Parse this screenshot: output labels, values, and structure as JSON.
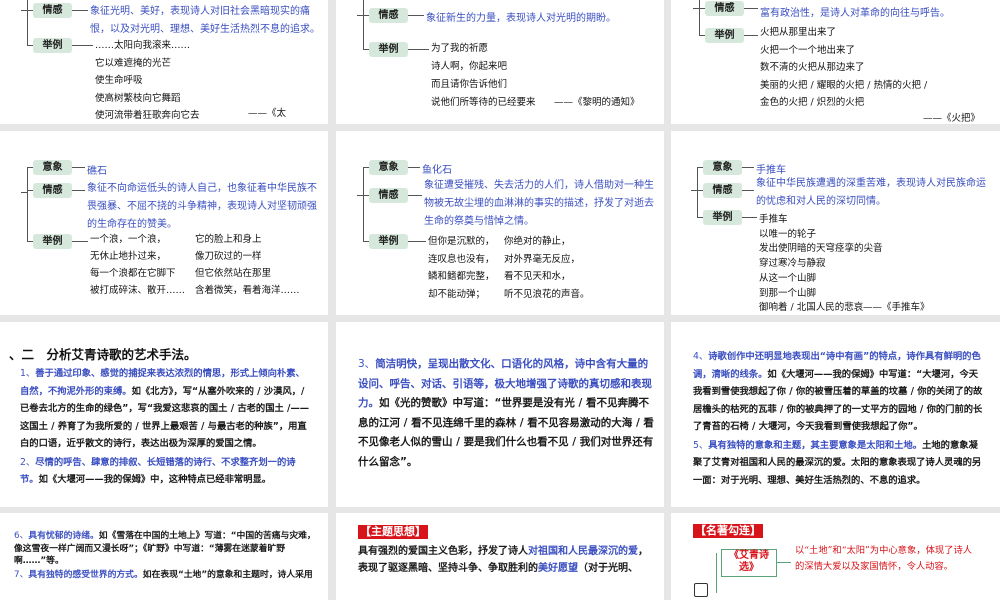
{
  "mindmaps": [
    {
      "nodes": [
        {
          "label": "情感",
          "text": [
            "象征光明、美好，表现诗人对旧社会黑暗现实的痛",
            "恨，以及对光明、理想、美好生活热烈不息的追求。"
          ]
        },
        {
          "label": "举例",
          "text": []
        }
      ],
      "poem_cols": [
        [
          "……太阳向我滚来……",
          "它以难遮掩的光芒",
          "使生命呼吸",
          "使高树繁枝向它舞蹈",
          "使河流带着狂歌奔向它去"
        ]
      ],
      "source": "——《太"
    },
    {
      "nodes": [
        {
          "label": "情感",
          "text": [
            "象征新生的力量，表现诗人对光明的期盼。"
          ]
        },
        {
          "label": "举例",
          "text": []
        }
      ],
      "poem_cols": [
        [
          "为了我的祈愿",
          "诗人啊，你起来吧",
          "而且请你告诉他们",
          "说他们所等待的已经要来"
        ]
      ],
      "source": "——《黎明的通知》"
    },
    {
      "nodes": [
        {
          "label": "情感",
          "text": [
            "富有政治性，是诗人对革命的向往与呼告。"
          ]
        },
        {
          "label": "举例",
          "text": []
        }
      ],
      "poem_cols": [
        [
          "火把从那里出来了",
          "火把一个一个地出来了",
          "数不清的火把从那边来了",
          "美丽的火把 / 耀眼的火把 / 热情的火把 /",
          "金色的火把 / 炽烈的火把"
        ]
      ],
      "source": "——《火把》"
    },
    {
      "nodes": [
        {
          "label": "意象",
          "text": [
            "礁石"
          ]
        },
        {
          "label": "情感",
          "text": [
            "象征不向命运低头的诗人自己，也象征着中华民族不",
            "畏强暴、不屈不挠的斗争精神，表现诗人对坚韧顽强",
            "的生命存在的赞美。"
          ]
        },
        {
          "label": "举例",
          "text": []
        }
      ],
      "poem_cols": [
        [
          "一个浪，一个浪，",
          "无休止地扑过来，",
          "每一个浪都在它脚下",
          "被打成碎沫、散开……"
        ],
        [
          "它的脸上和身上",
          "像刀砍过的一样",
          "但它依然站在那里",
          "含着微笑，看着海洋……"
        ]
      ],
      "source": ""
    },
    {
      "nodes": [
        {
          "label": "意象",
          "text": [
            "鱼化石"
          ]
        },
        {
          "label": "情感",
          "text": [
            "象征遭受摧残、失去活力的人们，诗人借助对一种生",
            "物被无故尘埋的血淋淋的事实的描述，抒发了对逝去",
            "生命的祭奠与惜悼之情。"
          ]
        },
        {
          "label": "举例",
          "text": []
        }
      ],
      "poem_cols": [
        [
          "但你是沉默的，",
          "连叹息也没有，",
          "鳞和鳍都完整，",
          "却不能动弹；"
        ],
        [
          "你绝对的静止，",
          "对外界毫无反应，",
          "看不见天和水，",
          "听不见浪花的声音。"
        ]
      ],
      "source": ""
    },
    {
      "nodes": [
        {
          "label": "意象",
          "text": [
            "手推车"
          ]
        },
        {
          "label": "情感",
          "text": [
            "象征中华民族遭遇的深重苦难，表现诗人对民族命运",
            "的忧虑和对人民的深切同情。"
          ]
        },
        {
          "label": "举例",
          "text": []
        }
      ],
      "poem_cols": [
        [
          "手推车",
          "以唯一的轮子",
          "发出使阴暗的天穹痉挛的尖音",
          "穿过寒冷与静寂",
          "从这一个山脚",
          "到那一个山脚",
          "御响着 / 北国人民的悲哀"
        ]
      ],
      "source": "——《手推车》"
    }
  ],
  "art_slide": {
    "title": "、二　分析艾青诗歌的艺术手法。",
    "paragraphs": [
      {
        "num": "1、",
        "blue": "善于通过印象、感觉的捕捉来表达浓烈的情思，形式上倾向朴素、自然，不拘泥外形的束缚。",
        "black": "如《北方》，写“从塞外吹来的 / 沙漠风，/ 已卷去北方的生命的绿色”，写“我爱这悲哀的国土 / 古老的国土 /—— 这国土 / 养育了为我所爱的 / 世界上最艰苦 / 与最古老的种族”，用直白的口语，近乎散文的诗行，表达出极为深厚的爱国之情。"
      },
      {
        "num": "2、",
        "blue": "尽情的呼告、肆意的排叙、长短错落的诗行、不求整齐划一的诗节。",
        "black": "如《大堰河——我的保姆》中，这种特点已经非常明显。"
      }
    ]
  },
  "art_slide_2": {
    "paragraphs": [
      {
        "num": "3、",
        "blue": "简洁明快，呈现出散文化、口语化的风格，诗中含有大量的设问、呼告、对话、引语等，极大地增强了诗歌的真切感和表现力。",
        "black": "如《光的赞歌》中写道：“世界要是没有光 / 看不见奔腾不息的江河 / 看不见连绵千里的森林 / 看不见容易激动的大海 / 看不见像老人似的雪山 / 要是我们什么也看不见 / 我们对世界还有什么留念”。"
      }
    ]
  },
  "art_slide_3": {
    "paragraphs": [
      {
        "num": "4、",
        "blue": "诗歌创作中还明显地表现出“诗中有画”的特点，诗作具有鲜明的色调，清晰的线条。",
        "black": "如《大堰河——我的保姆》中写道：“大堰河，今天我看到雪使我想起了你 / 你的被雪压着的草盖的坟墓 / 你的关闭了的故居檐头的枯死的瓦菲 / 你的被典押了的一丈平方的园地 / 你的门前的长了青苔的石椅 / 大堰河，今天我看到雪使我想起了你”。"
      },
      {
        "num": "5、",
        "blue": "具有独特的意象和主题，其主要意象是太阳和土地。",
        "black": "土地的意象凝聚了艾青对祖国和人民的最深沉的爱。太阳的意象表现了诗人灵魂的另一面：对于光明、理想、美好生活热烈的、不息的追求。"
      }
    ]
  },
  "art_slide_4": {
    "paragraphs": [
      {
        "num": "6、",
        "blue": "具有忧郁的诗绪。",
        "black": "如《雪落在中国的土地上》写道：“中国的苦痛与灾难，像这雪夜一样广阔而又漫长呀”；《旷野》中写道：“薄雾在迷蒙着旷野啊……”等。"
      },
      {
        "num": "7、",
        "blue": "具有独特的感受世界的方式。",
        "black": "如在表现“土地”的意象和主题时，诗人采用"
      }
    ]
  },
  "theme_slide": {
    "tag": "【主题思想】",
    "segments": [
      {
        "t": "具有强烈的爱国主义色彩，抒发了诗人",
        "c": "k0"
      },
      {
        "t": "对祖国和人民最深沉的爱",
        "c": "b"
      },
      {
        "t": "，表现了驱逐黑暗、坚持斗争、争取胜利的",
        "c": "k0"
      },
      {
        "t": "美好愿望",
        "c": "b"
      },
      {
        "t": "（对于光明、",
        "c": "k0"
      }
    ]
  },
  "link_slide": {
    "tag": "【名著勾连】",
    "book": "《艾青诗选》",
    "text": "以“土地”和“太阳”为中心意象，体现了诗人的深情大爱以及家国情怀，令人动容。"
  }
}
